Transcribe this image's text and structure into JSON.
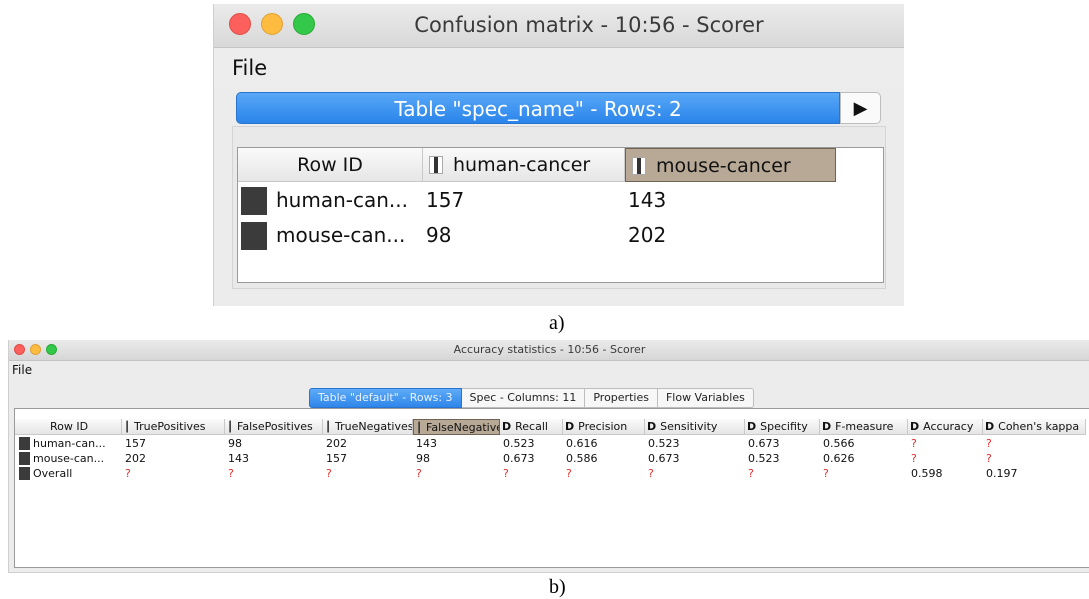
{
  "colors": {
    "accent_tab": "#2f86ea",
    "selected_header": "#b8a996",
    "missing_value": "#e03030"
  },
  "window_a": {
    "title": "Confusion matrix - 10:56 - Scorer",
    "menu": [
      "File"
    ],
    "tab_label": "Table \"spec_name\" - Rows: 2",
    "arrow_icon": "play-arrow-icon",
    "columns": [
      "Row ID",
      "human-cancer",
      "mouse-cancer"
    ],
    "rows": [
      [
        "human-can...",
        "157",
        "143"
      ],
      [
        "mouse-can...",
        "98",
        "202"
      ]
    ]
  },
  "caption_a": "a)",
  "window_b": {
    "title": "Accuracy statistics - 10:56 - Scorer",
    "menu": [
      "File"
    ],
    "tabs": [
      "Table \"default\" - Rows: 3",
      "Spec - Columns: 11",
      "Properties",
      "Flow Variables"
    ],
    "columns": [
      {
        "label": "Row ID",
        "type": ""
      },
      {
        "label": "TruePositives",
        "type": "I"
      },
      {
        "label": "FalsePositives",
        "type": "I"
      },
      {
        "label": "TrueNegatives",
        "type": "I"
      },
      {
        "label": "FalseNegatives",
        "type": "I"
      },
      {
        "label": "Recall",
        "type": "D"
      },
      {
        "label": "Precision",
        "type": "D"
      },
      {
        "label": "Sensitivity",
        "type": "D"
      },
      {
        "label": "Specifity",
        "type": "D"
      },
      {
        "label": "F-measure",
        "type": "D"
      },
      {
        "label": "Accuracy",
        "type": "D"
      },
      {
        "label": "Cohen's kappa",
        "type": "D"
      }
    ],
    "rows": [
      [
        "human-can...",
        "157",
        "98",
        "202",
        "143",
        "0.523",
        "0.616",
        "0.523",
        "0.673",
        "0.566",
        "?",
        "?"
      ],
      [
        "mouse-can...",
        "202",
        "143",
        "157",
        "98",
        "0.673",
        "0.586",
        "0.673",
        "0.523",
        "0.626",
        "?",
        "?"
      ],
      [
        "Overall",
        "?",
        "?",
        "?",
        "?",
        "?",
        "?",
        "?",
        "?",
        "?",
        "0.598",
        "0.197"
      ]
    ]
  },
  "caption_b": "b)"
}
